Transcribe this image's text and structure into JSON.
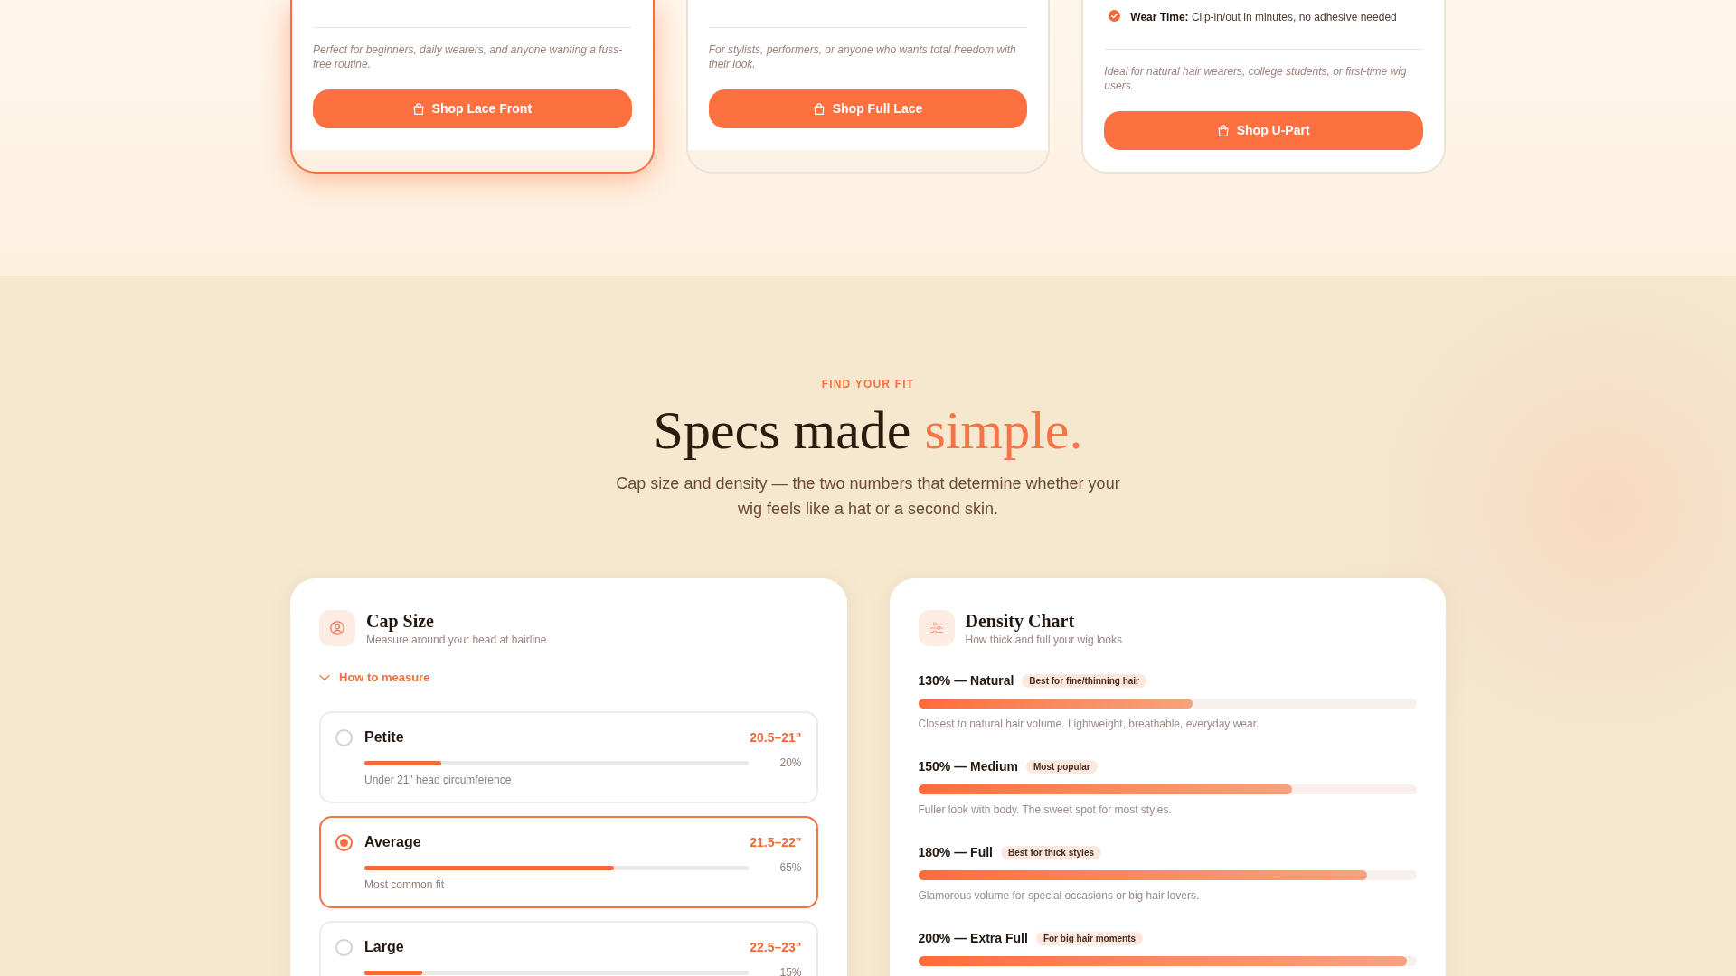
{
  "product_cards": [
    {
      "highlighted": true,
      "description": "Perfect for beginners, daily wearers, and anyone wanting a fuss-free routine.",
      "button": "Shop Lace Front"
    },
    {
      "highlighted": false,
      "description": "For stylists, performers, or anyone who wants total freedom with their look.",
      "button": "Shop Full Lace"
    },
    {
      "highlighted": false,
      "features": [
        "**Wear Time:** Clip-in/out in minutes, no adhesive needed"
      ],
      "description": "Ideal for natural hair wearers, college students, or first-time wig users.",
      "button": "Shop U-Part"
    }
  ],
  "fit_section": {
    "eyebrow": "FIND YOUR FIT",
    "title": "Specs made",
    "title_accent": "simple.",
    "intro": "Cap size and density — the two numbers that determine whether your wig feels like a hat or a second skin."
  },
  "cap_size": {
    "title": "Cap Size",
    "subtitle": "Measure around your head at hairline",
    "toggle": {
      "label": "How to measure",
      "expanded": false
    },
    "options": [
      {
        "name": "Petite",
        "range": "20.5–21\"",
        "level": 0.2,
        "share": "20%",
        "note": "Under 21\" head circumference",
        "selected": false
      },
      {
        "name": "Average",
        "range": "21.5–22\"",
        "level": 0.65,
        "share": "65%",
        "note": "Most common fit",
        "selected": true
      },
      {
        "name": "Large",
        "range": "22.5–23\"",
        "level": 0.15,
        "share": "15%",
        "selected": false
      }
    ]
  },
  "density": {
    "title": "Density Chart",
    "subtitle": "How thick and full your wig looks",
    "levels": [
      {
        "label": "130% — Natural",
        "tag": "Best for fine/thinning hair",
        "level": 0.55,
        "note": "Closest to natural hair volume. Lightweight, breathable, everyday wear."
      },
      {
        "label": "150% — Medium",
        "tag": "Most popular",
        "level": 0.75,
        "note": "Fuller look with body. The sweet spot for most styles."
      },
      {
        "label": "180% — Full",
        "tag": "Best for thick styles",
        "level": 0.9,
        "note": "Glamorous volume for special occasions or big hair lovers."
      },
      {
        "label": "200% — Extra Full",
        "tag": "For big hair moments",
        "level": 0.98
      }
    ]
  }
}
